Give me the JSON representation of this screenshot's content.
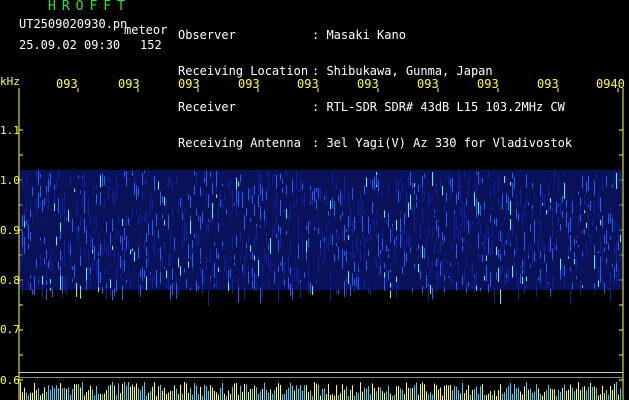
{
  "header": {
    "brand": "HROFFT",
    "file_name": "UT2509020930.pn",
    "meteor_label": "meteor",
    "date_time": "25.09.02 09:30",
    "count": "152"
  },
  "meta": [
    {
      "key": "Observer",
      "value": ": Masaki Kano"
    },
    {
      "key": "Receiving Location",
      "value": ": Shibukawa, Gunma, Japan"
    },
    {
      "key": "Receiver",
      "value": ": RTL-SDR SDR# 43dB L15 103.2MHz CW"
    },
    {
      "key": "Receiving Antenna",
      "value": ": 3el Yagi(V) Az 330 for Vladivostok"
    }
  ],
  "axes": {
    "y_unit": "kHz",
    "y_ticks": [
      "1.1",
      "1.0",
      "0.9",
      "0.8",
      "0.7",
      "0.6"
    ],
    "x_ticks": [
      "093",
      "093",
      "093",
      "093",
      "093",
      "093",
      "093",
      "093",
      "093",
      "0940"
    ]
  },
  "colors": {
    "background": "#000000",
    "axis": "#ffff40",
    "signal_low": "#1020a0",
    "signal_mid": "#2060ff",
    "signal_high": "#40ffff",
    "brand": "#30e030"
  },
  "chart_data": {
    "type": "heatmap",
    "ylabel": "kHz",
    "ylim": [
      0.6,
      1.15
    ],
    "x_tick_labels": [
      "093",
      "093",
      "093",
      "093",
      "093",
      "093",
      "093",
      "093",
      "093",
      "0940"
    ],
    "band_khz": [
      0.78,
      1.02
    ],
    "reference_line_khz": 0.615
  }
}
